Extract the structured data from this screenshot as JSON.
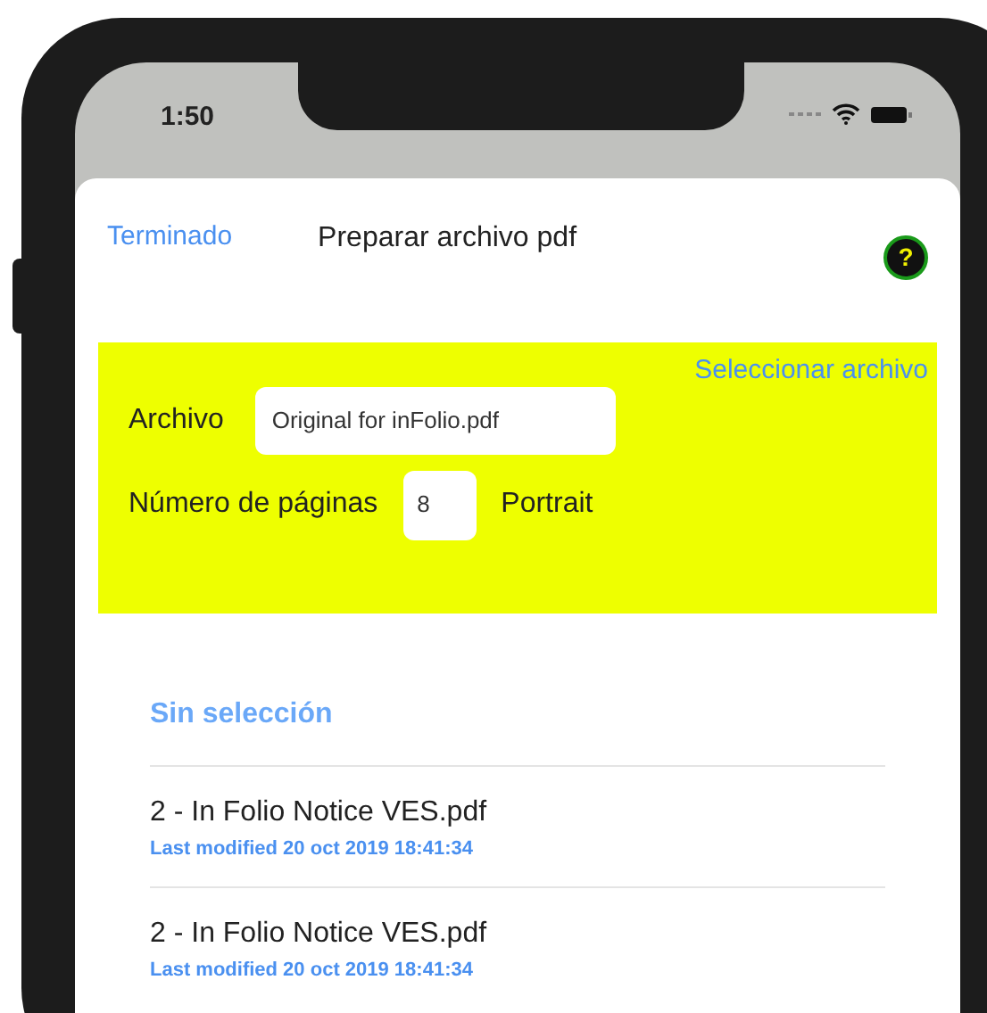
{
  "status_bar": {
    "time": "1:50"
  },
  "nav": {
    "done": "Terminado",
    "title": "Preparar archivo pdf",
    "help": "?"
  },
  "file_panel": {
    "select_link": "Seleccionar archivo",
    "file_label": "Archivo",
    "file_value": "Original for inFolio.pdf",
    "pages_label": "Número de páginas",
    "pages_value": "8",
    "orientation": "Portrait"
  },
  "list": {
    "header": "Sin selección",
    "items": [
      {
        "name": "2 - In Folio Notice VES.pdf",
        "modified": "Last modified 20 oct 2019 18:41:34"
      },
      {
        "name": "2 - In Folio Notice VES.pdf",
        "modified": "Last modified 20 oct 2019 18:41:34"
      }
    ]
  }
}
